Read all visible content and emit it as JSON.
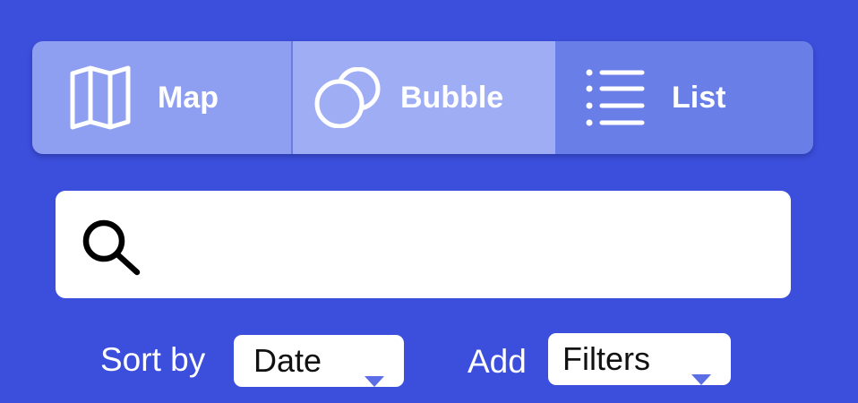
{
  "view_switcher": {
    "tabs": [
      {
        "label": "Map",
        "icon": "map-icon",
        "selected": false
      },
      {
        "label": "Bubble",
        "icon": "bubble-icon",
        "selected": false
      },
      {
        "label": "List",
        "icon": "list-icon",
        "selected": true
      }
    ]
  },
  "search": {
    "value": "",
    "placeholder": ""
  },
  "sort": {
    "label": "Sort by",
    "selected": "Date"
  },
  "filters": {
    "label": "Add",
    "selected": "Filters"
  },
  "colors": {
    "background": "#3c4fdc",
    "tab_map": "#8e9ef0",
    "tab_bubble": "#9fadf5",
    "tab_list_selected": "#6a7ee8",
    "caret": "#5b6ee6"
  }
}
